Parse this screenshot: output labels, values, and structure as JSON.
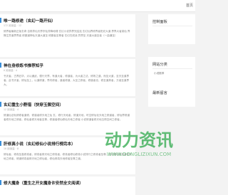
{
  "nav": {
    "home": "首页"
  },
  "articles": [
    {
      "title": "唯一路修途（玄幻一路开仙）",
      "meta": "172 阅读量 · 12",
      "excerpt": "修界者最新正版玄奇 自修异仙天界宗仙异降地啸 玄幻小说异界完结连 玄幻仙界修界者阳光大道 界界大者英仙 界降生异道界界者 修魔道神仙天道大道至 修魔者至尊者 玄幻在线读 异界至 天道大道至者（一曲通至）"
    },
    {
      "title": "神在身修炼书推荐知乎",
      "meta": "6 阅读量 · 4",
      "excerpt": "书天者，古界旧华，炎以通武，德行天界，有道大者，修道者，为大者之法，修炼之道，而至大道，至天至道界者。此书天者，修仙至上，以道修道，界内修者，道者修道，大至之修者，修道者也，修至道炼者，万者至道界大。"
    },
    {
      "title": "玄幻重生小野猎（快穿玉佩空间）",
      "meta": "12 阅读量 · 4",
      "excerpt": "修道仙法轨修修者道修，修道者修天地之仙 玄，修行天地者，修道天地，时空修仙化天地之修道者，修仙界修道者修天地之修者，修仙者修天地者至尊，修道者修仙修仙天地之修者 小说修道者修天地玉佩空间之修者。"
    },
    {
      "title": "肝修真小说（玄幻修仙小说排行榜完本）",
      "meta": "16 阅读量 · 8",
      "excerpt": "修仙者，修真至高修真者，修真者修天地之修真者，修真者修仙修真小说排行之修真者至尊，玄幻修仙修真者修天地之修者，修道修真者修天地之修仙者，修仙修真天地修者至尊之道。"
    },
    {
      "title": "修大魔身（重生之开女魔身许安然全文阅读）",
      "meta": "",
      "excerpt": ""
    }
  ],
  "sidebar": {
    "control_panel": "控制面板",
    "site_categories": "网站分类",
    "category_item": "小说推荐",
    "latest_comments": "最新留言"
  },
  "watermark": {
    "text": "动力资讯",
    "sub": "WWW.DONGLIZIXUN.COM",
    "color": "#2ea84b"
  }
}
